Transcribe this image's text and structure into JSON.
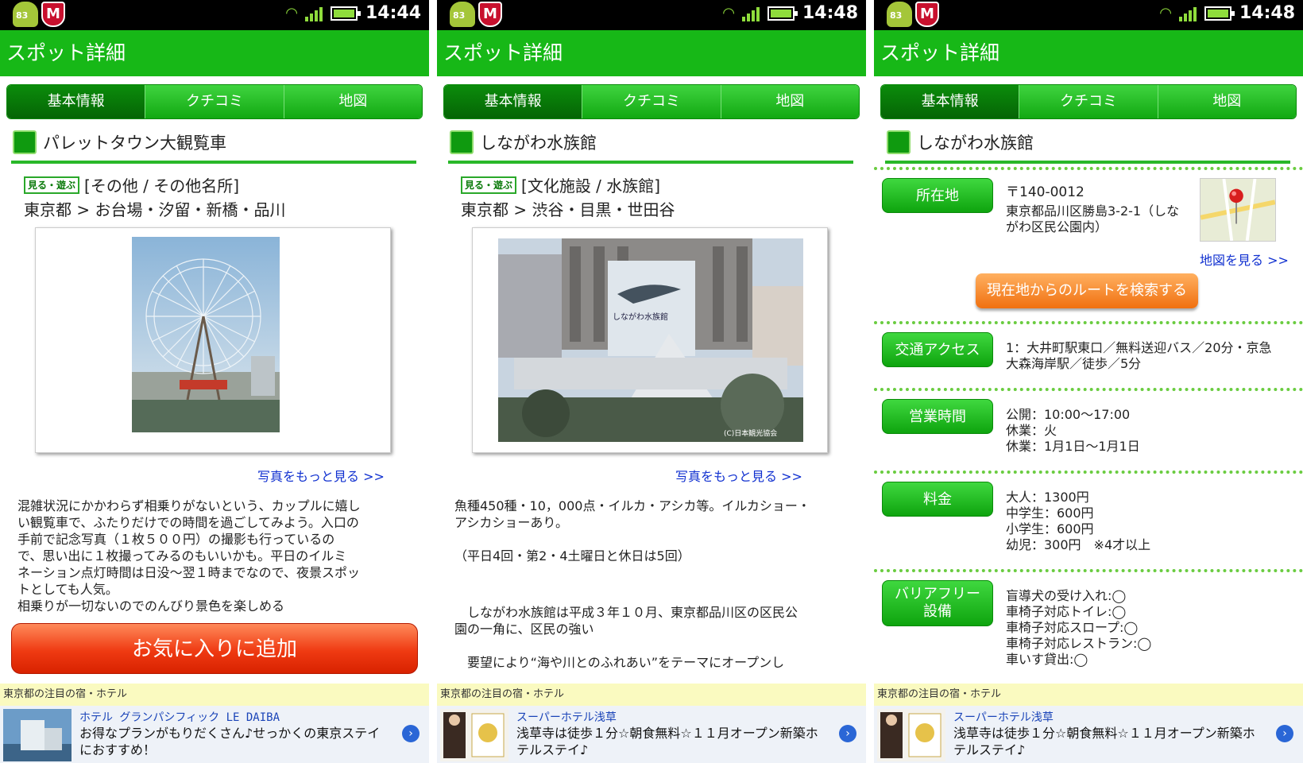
{
  "status_bar": {
    "android_badge": "83",
    "mcafee_label": "M"
  },
  "titlebar": {
    "title": "スポット詳細"
  },
  "tabs": [
    {
      "label": "基本情報"
    },
    {
      "label": "クチコミ"
    },
    {
      "label": "地図"
    }
  ],
  "screens": [
    {
      "time": "14:44",
      "spot_name": "パレットタウン大観覧車",
      "badge_label": "見る・遊ぶ",
      "category": "[その他 / その他名所]",
      "area": "東京都 > お台場・汐留・新橋・品川",
      "more_photos": "写真をもっと見る >>",
      "description": [
        "混雑状況にかかわらず相乗りがないという、カップルに嬉し",
        "い観覧車で、ふたりだけでの時間を過ごしてみよう。入口の",
        "手前で記念写真（１枚５００円）の撮影も行っているの",
        "で、思い出に１枚撮ってみるのもいいかも。平日のイルミ",
        "ネーション点灯時間は日没～翌１時までなので、夜景スポッ",
        "トとしても人気。",
        "相乗りが一切ないのでのんびり景色を楽しめる"
      ],
      "favorite_button": "お気に入りに追加",
      "ad": {
        "header": "東京都の注目の宿・ホテル",
        "title": "ホテル グランパシフィック LE DAIBA",
        "text": "お得なプランがもりだくさん♪せっかくの東京ステイにおすすめ！"
      }
    },
    {
      "time": "14:48",
      "spot_name": "しながわ水族館",
      "badge_label": "見る・遊ぶ",
      "category": "[文化施設 / 水族館]",
      "area": "東京都 > 渋谷・目黒・世田谷",
      "more_photos": "写真をもっと見る >>",
      "photo_sign": "しながわ水族館",
      "photo_credit": "(C)日本観光協会",
      "description": [
        "魚種450種・10，000点・イルカ・アシカ等。イルカショー・",
        "アシカショーあり。",
        "",
        "（平日4回・第2・4土曜日と休日は5回）",
        "",
        "",
        "　しながわ水族館は平成３年１０月、東京都品川区の区民公",
        "園の一角に、区民の強い",
        "",
        "　要望により“海や川とのふれあい”をテーマにオープンし"
      ],
      "ad": {
        "header": "東京都の注目の宿・ホテル",
        "title": "スーパーホテル浅草",
        "text": "浅草寺は徒歩１分☆朝食無料☆１１月オープン新築ホテルステイ♪"
      }
    },
    {
      "time": "14:48",
      "spot_name": "しながわ水族館",
      "info": [
        {
          "label": "所在地",
          "lines": [
            "〒140-0012",
            "東京都品川区勝島3-2-1（しな",
            "がわ区民公園内）"
          ]
        },
        {
          "label": "交通アクセス",
          "lines": [
            "1：大井町駅東口／無料送迎バス／20分・京急",
            "大森海岸駅／徒歩／5分"
          ]
        },
        {
          "label": "営業時間",
          "lines": [
            "公開：10:00～17:00",
            "休業：火",
            "休業：1月1日～1月1日"
          ]
        },
        {
          "label": "料金",
          "lines": [
            "大人：1300円",
            "中学生：600円",
            "小学生：600円",
            "幼児：300円　※4才以上"
          ]
        },
        {
          "label_lines": [
            "バリアフリー",
            "設備"
          ],
          "lines": [
            "盲導犬の受け入れ:◯",
            "車椅子対応トイレ:◯",
            "車椅子対応スロープ:◯",
            "車椅子対応レストラン:◯",
            "車いす貸出:◯"
          ]
        }
      ],
      "map_link": "地図を見る >>",
      "route_button": "現在地からのルートを検索する",
      "ad": {
        "header": "東京都の注目の宿・ホテル",
        "title": "スーパーホテル浅草",
        "text": "浅草寺は徒歩１分☆朝食無料☆１１月オープン新築ホテルステイ♪"
      }
    }
  ],
  "colors": {
    "green": "#17b817",
    "orange": "#f07010",
    "red": "#ef3a12",
    "link": "#1030d0"
  }
}
